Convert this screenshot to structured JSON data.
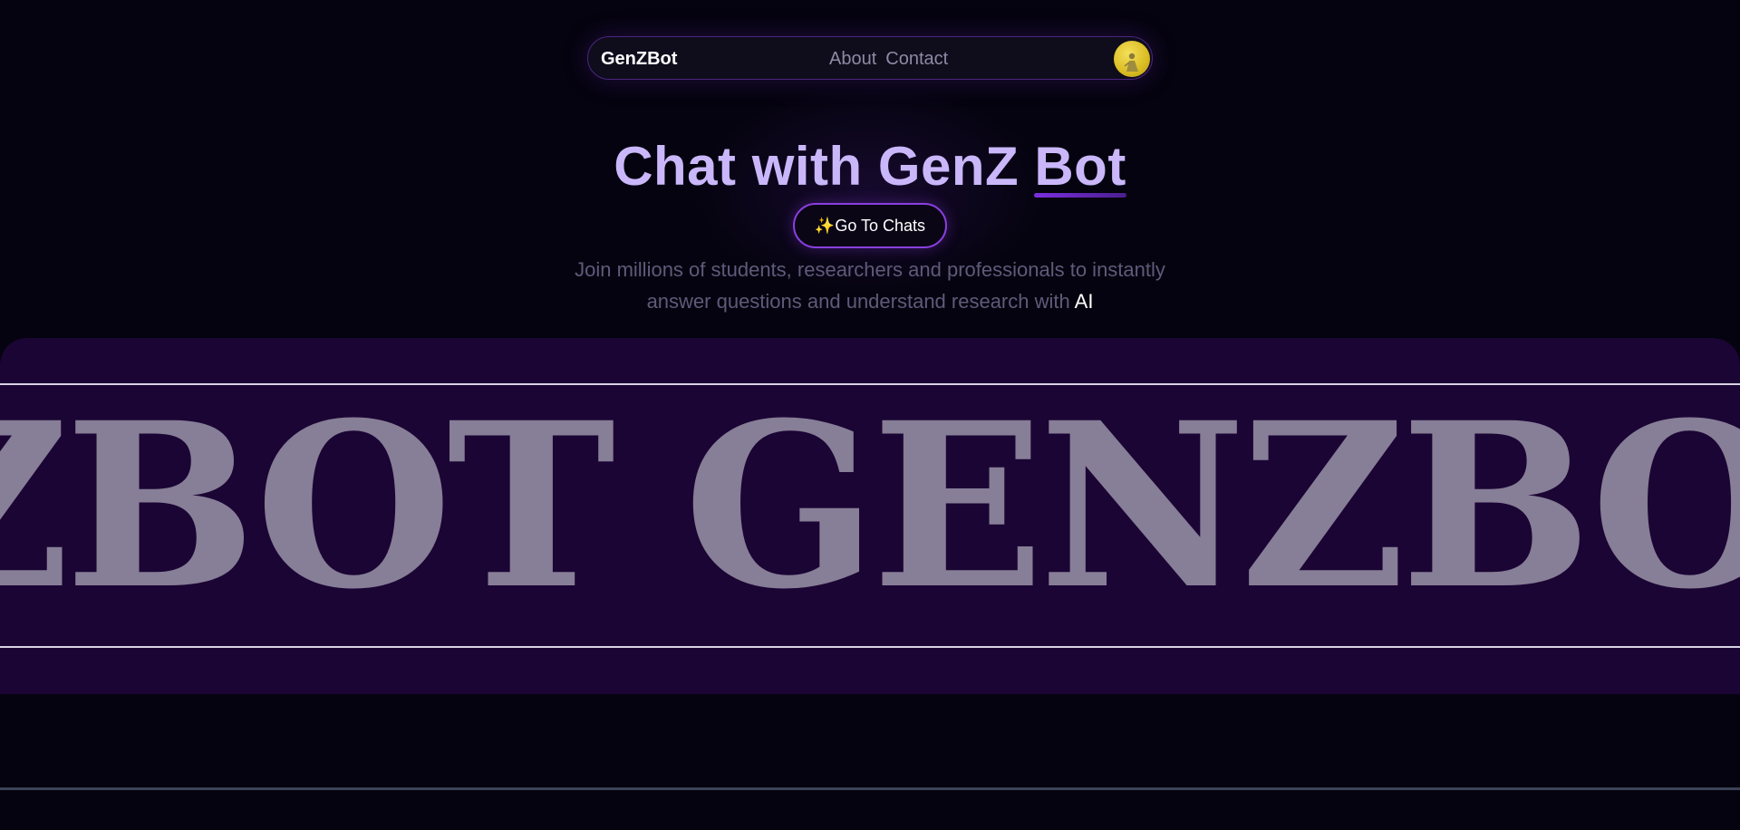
{
  "navbar": {
    "brand": "GenZBot",
    "links": [
      "About",
      "Contact"
    ]
  },
  "hero": {
    "title_main": "Chat with GenZ",
    "title_accent": "Bot",
    "cta_label": "✨Go To Chats",
    "subtitle_line1": "Join millions of students, researchers and professionals to instantly",
    "subtitle_line2": "answer questions and understand research with",
    "subtitle_highlight": "AI"
  },
  "banner": {
    "marquee_text": "ZBOT GENZBOT"
  },
  "colors": {
    "background": "#05030f",
    "accent_purple": "#8a3fe0",
    "title_lavender": "#c9b7fa",
    "banner_bg": "#1b0534",
    "avatar_yellow": "#d9bc22"
  }
}
